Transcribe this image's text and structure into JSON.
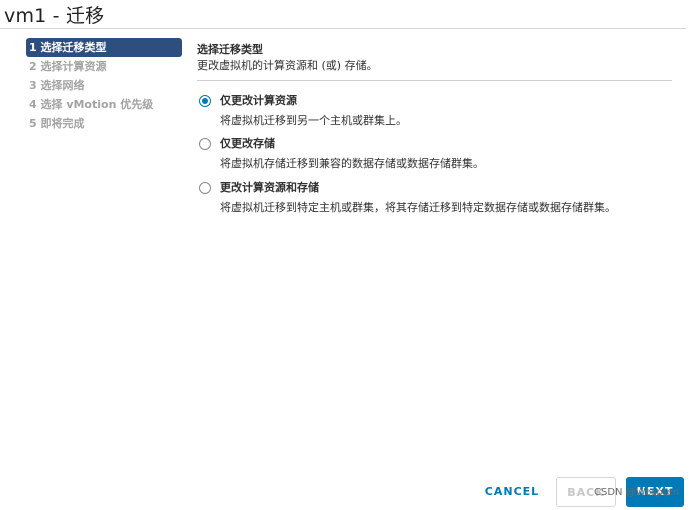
{
  "window": {
    "title": "vm1 - 迁移"
  },
  "steps": [
    {
      "label": "1 选择迁移类型"
    },
    {
      "label": "2 选择计算资源"
    },
    {
      "label": "3 选择网络"
    },
    {
      "label": "4 选择 vMotion 优先级"
    },
    {
      "label": "5 即将完成"
    }
  ],
  "active_step": 0,
  "main": {
    "heading": "选择迁移类型",
    "description": "更改虚拟机的计算资源和 (或) 存储。",
    "options": [
      {
        "label": "仅更改计算资源",
        "description": "将虚拟机迁移到另一个主机或群集上。",
        "selected": true
      },
      {
        "label": "仅更改存储",
        "description": "将虚拟机存储迁移到兼容的数据存储或数据存储群集。",
        "selected": false
      },
      {
        "label": "更改计算资源和存储",
        "description": "将虚拟机迁移到特定主机或群集，将其存储迁移到特定数据存储或数据存储群集。",
        "selected": false
      }
    ]
  },
  "footer": {
    "cancel_label": "CANCEL",
    "back_label": "BACK",
    "next_label": "NEXT"
  },
  "watermark": "CSDN @Wespten",
  "colors": {
    "active_step_bg": "#2e4e7f",
    "primary": "#0079b8",
    "muted_text": "#a3a3a3"
  }
}
